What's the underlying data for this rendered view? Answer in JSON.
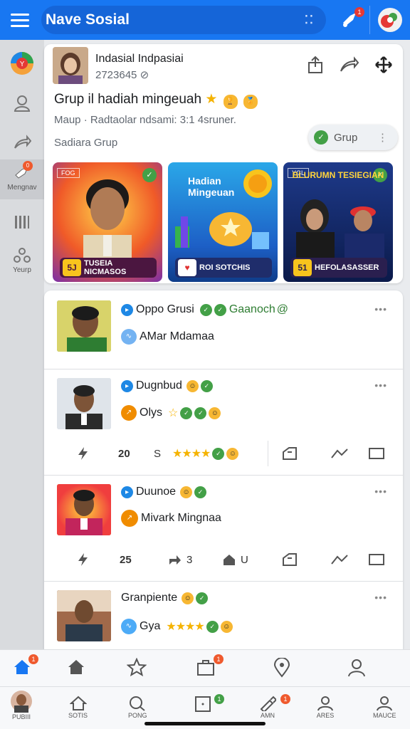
{
  "app": {
    "title": "Nave Sosial",
    "notif_count": "1",
    "accent": "#1877f2"
  },
  "rail": {
    "items": [
      {
        "icon": "logo-icon",
        "label": ""
      },
      {
        "icon": "user-icon",
        "label": ""
      },
      {
        "icon": "share-icon",
        "label": ""
      },
      {
        "icon": "megaphone-icon",
        "label": "Mengnav",
        "badge": "0"
      },
      {
        "icon": "bars-icon",
        "label": ""
      },
      {
        "icon": "group-icon",
        "label": "Yeurp"
      }
    ]
  },
  "group_card": {
    "name": "Indasial Indpasiai",
    "handle": "2723645",
    "title": "Grup il hadiah mingeuah",
    "meta": "Maup · Radtaolar ndsami: 3:1 4sruner.",
    "sub": "Sadiara Grup",
    "grup_button": "Grup",
    "tiles": [
      {
        "tag": "FOG",
        "badge": "5J",
        "caption": "TUSEIA NICMASOS"
      },
      {
        "headline": "Hadian Mingeuan",
        "caption": "ROI SOTCHIS"
      },
      {
        "tag": "YGL",
        "headline": "BLURUMN TESIEGIAN",
        "badge": "51",
        "caption": "HEFOLASASSER"
      }
    ]
  },
  "feed": {
    "posts": [
      {
        "line1": "Oppo Grusi",
        "line1_extra": "Gaanoch",
        "line2": "AMar Mdamaa"
      },
      {
        "line1": "Dugnbud",
        "line2": "Olys",
        "actions": {
          "count1": "20",
          "count2": "S"
        }
      },
      {
        "line1": "Duunoe",
        "line2": "Mivark Mingnaa",
        "actions": {
          "count1": "25",
          "count2": "3",
          "count3": "U"
        }
      },
      {
        "line1": "Granpiente",
        "line2": "Gya"
      }
    ]
  },
  "bottom_nav_1": {
    "items": [
      {
        "icon": "home-icon",
        "badge": "1"
      },
      {
        "icon": "home-outline-icon"
      },
      {
        "icon": "star-icon"
      },
      {
        "icon": "bag-icon",
        "badge": "1"
      },
      {
        "icon": "location-icon"
      },
      {
        "icon": "profile-icon"
      }
    ]
  },
  "bottom_nav_2": {
    "items": [
      {
        "icon": "avatar",
        "label": "PUBIII"
      },
      {
        "icon": "home-icon",
        "label": "SOTIS"
      },
      {
        "icon": "search-icon",
        "label": "PONG"
      },
      {
        "icon": "notes-icon",
        "label": "",
        "badge": "1"
      },
      {
        "icon": "pen-icon",
        "label": "AMN",
        "badge": "1"
      },
      {
        "icon": "people-icon",
        "label": "ARES"
      },
      {
        "icon": "account-icon",
        "label": "MAUCE"
      }
    ]
  }
}
